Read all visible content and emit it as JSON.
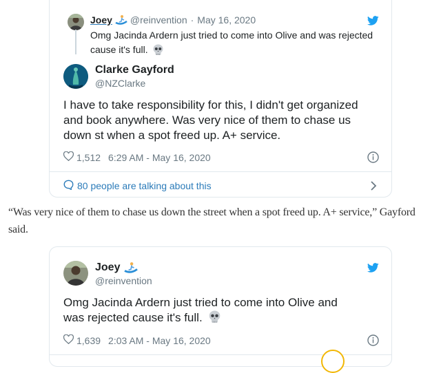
{
  "embed1": {
    "quoted": {
      "name": "Joey",
      "handle": "@reinvention",
      "sep": "·",
      "date": "May 16, 2020",
      "text_line1": "Omg Jacinda Ardern just tried to come into Olive and was rejected",
      "text_line2": "cause it's full.",
      "emoji": "skull-icon"
    },
    "author": {
      "name": "Clarke Gayford",
      "handle": "@NZClarke"
    },
    "text": "I have to take responsibility for this, I didn't get organized and book anywhere. Was very nice of them to chase us down st when a spot freed up. A+ service.",
    "likes": "1,512",
    "timestamp": "6:29 AM - May 16, 2020",
    "talking": "80 people are talking about this",
    "accent_color": "#1da1f2",
    "link_color": "#2b7bb9"
  },
  "article": {
    "paragraph": "“Was very nice of them to chase us down the street when a spot freed up. A+ service,” Gayford said."
  },
  "embed2": {
    "author": {
      "name": "Joey",
      "handle": "@reinvention"
    },
    "text": "Omg Jacinda Ardern just tried to come into Olive and was rejected cause it's full.",
    "likes": "1,639",
    "timestamp": "2:03 AM - May 16, 2020"
  }
}
